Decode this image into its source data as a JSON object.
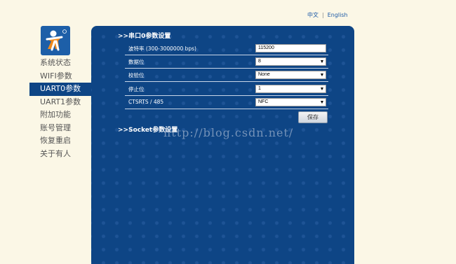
{
  "lang": {
    "chinese": "中文",
    "separator": "|",
    "english": "English"
  },
  "logo": {
    "icon": "person-logo-icon"
  },
  "nav": {
    "items": [
      {
        "label": "系统状态"
      },
      {
        "label": "WIFI参数"
      },
      {
        "label": "UART0参数"
      },
      {
        "label": "UART1参数"
      },
      {
        "label": "附加功能"
      },
      {
        "label": "账号管理"
      },
      {
        "label": "恢复重启"
      },
      {
        "label": "关于有人"
      }
    ],
    "active_index": 2
  },
  "panel": {
    "uart_section_title": ">>串口0参数设置",
    "socket_section_title": ">>Socket参数设置",
    "fields": {
      "baud": {
        "label": "波特率 (300-3000000 bps)",
        "value": "115200"
      },
      "data_bits": {
        "label": "数据位",
        "value": "8"
      },
      "parity": {
        "label": "校验位",
        "value": "None"
      },
      "stop_bits": {
        "label": "停止位",
        "value": "1"
      },
      "flow": {
        "label": "CTSRTS / 485",
        "value": "NFC"
      }
    },
    "save_label": "保存"
  },
  "watermark": "http://blog.csdn.net/",
  "colors": {
    "panel": "#0e4585",
    "background": "#fbf7e6",
    "active_nav": "#0e4585"
  }
}
